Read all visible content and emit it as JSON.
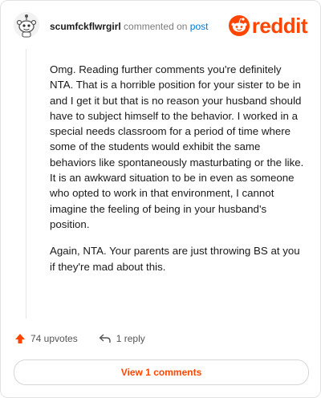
{
  "comment": {
    "username": "scumfckflwrgirl",
    "action_text": "commented on",
    "post_link": "post",
    "body": [
      "Omg. Reading further comments you're definitely NTA. That is a horrible position for your sister to be in and I get it but that is no reason your husband should have to subject himself to the behavior. I worked in a special needs classroom for a period of time where some of the students would exhibit the same behaviors like spontaneously masturbating or the like. It is an awkward situation to be in even as someone who opted to work in that environment, I cannot imagine the feeling of being in your husband's position.",
      "Again, NTA. Your parents are just throwing BS at you if they're mad about this."
    ]
  },
  "brand": {
    "logo_text": "reddit",
    "color": "#ff4500"
  },
  "actions": {
    "upvotes": "74 upvotes",
    "replies": "1 reply"
  },
  "view_comments_label": "View 1 comments",
  "icons": {
    "avatar": "snoo-avatar-icon",
    "logo": "reddit-snoo-icon",
    "upvote": "upvote-arrow-icon",
    "reply": "reply-arrow-icon"
  }
}
